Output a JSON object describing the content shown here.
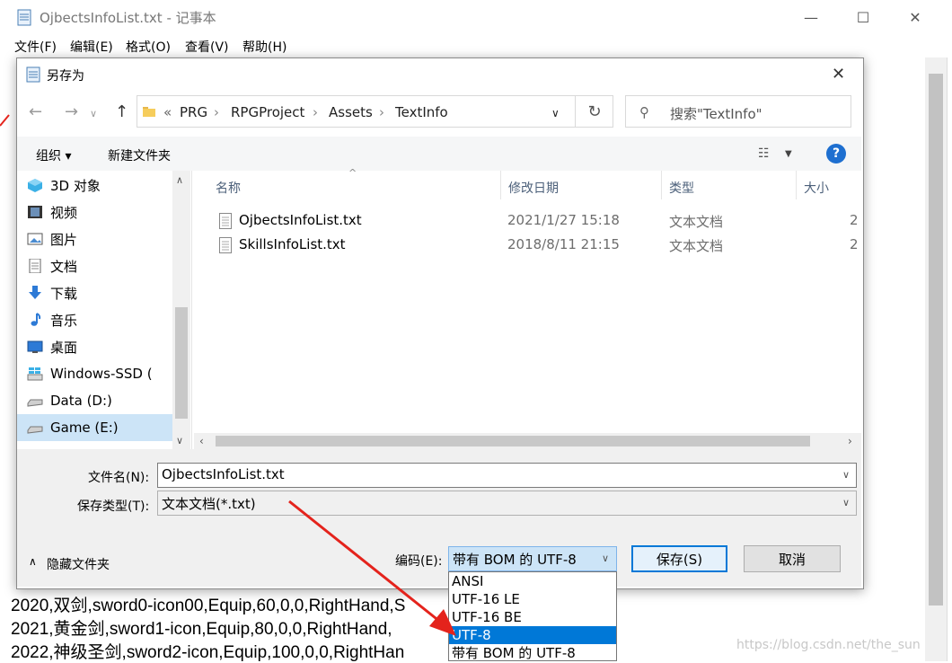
{
  "notepad": {
    "title": "OjbectsInfoList.txt - 记事本",
    "menu": [
      "文件(F)",
      "编辑(E)",
      "格式(O)",
      "查看(V)",
      "帮助(H)"
    ],
    "window_controls": [
      "—",
      "☐",
      "✕"
    ],
    "lines": [
      "2020,双剑,sword0-icon00,Equip,60,0,0,RightHand,S",
      "2021,黄金剑,sword1-icon,Equip,80,0,0,RightHand,",
      "2022,神级圣剑,sword2-icon,Equip,100,0,0,RightHan"
    ]
  },
  "dialog": {
    "title": "另存为",
    "close": "✕",
    "breadcrumb": [
      "PRG",
      "RPGProject",
      "Assets",
      "TextInfo"
    ],
    "breadcrumb_prefix": "«",
    "search_placeholder": "搜索\"TextInfo\"",
    "toolbar": {
      "organize": "组织 ▾",
      "new_folder": "新建文件夹",
      "help": "?"
    },
    "nav_items": [
      {
        "label": "3D 对象",
        "icon": "3d-object-icon"
      },
      {
        "label": "视频",
        "icon": "video-icon"
      },
      {
        "label": "图片",
        "icon": "picture-icon"
      },
      {
        "label": "文档",
        "icon": "document-icon"
      },
      {
        "label": "下载",
        "icon": "download-icon"
      },
      {
        "label": "音乐",
        "icon": "music-icon"
      },
      {
        "label": "桌面",
        "icon": "desktop-icon"
      },
      {
        "label": "Windows-SSD (",
        "icon": "windows-drive-icon"
      },
      {
        "label": "Data (D:)",
        "icon": "drive-icon"
      },
      {
        "label": "Game (E:)",
        "icon": "drive-icon"
      }
    ],
    "columns": {
      "name": "名称",
      "modified": "修改日期",
      "type": "类型",
      "size": "大小"
    },
    "files": [
      {
        "name": "OjbectsInfoList.txt",
        "modified": "2021/1/27 15:18",
        "type": "文本文档",
        "size": "2"
      },
      {
        "name": "SkillsInfoList.txt",
        "modified": "2018/8/11 21:15",
        "type": "文本文档",
        "size": "2"
      }
    ],
    "filename_label": "文件名(N):",
    "filename_value": "OjbectsInfoList.txt",
    "filetype_label": "保存类型(T):",
    "filetype_value": "文本文档(*.txt)",
    "hide_folders": "隐藏文件夹",
    "encoding_label": "编码(E):",
    "encoding_value": "带有 BOM 的 UTF-8",
    "encoding_options": [
      "ANSI",
      "UTF-16 LE",
      "UTF-16 BE",
      "UTF-8",
      "带有 BOM 的 UTF-8"
    ],
    "encoding_highlighted": "UTF-8",
    "save_button": "保存(S)",
    "cancel_button": "取消"
  },
  "watermark": "https://blog.csdn.net/the_sun",
  "colors": {
    "accent": "#0078d7",
    "annotation_arrow": "#e4231c",
    "selection": "#cce4f7"
  }
}
